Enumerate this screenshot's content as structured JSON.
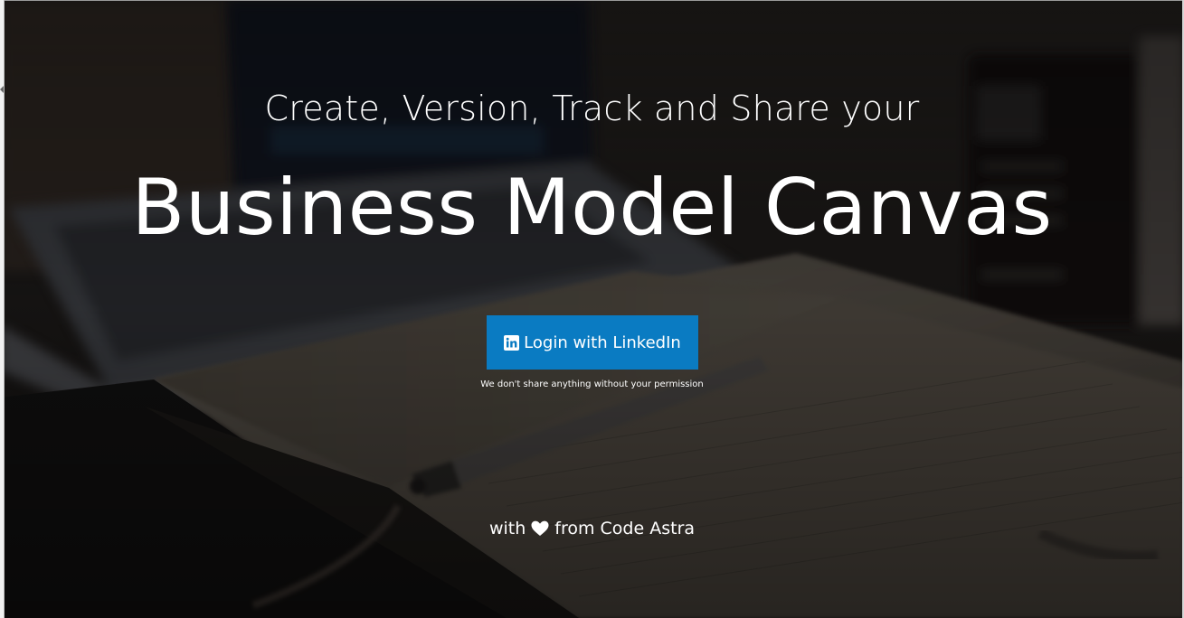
{
  "hero": {
    "subtitle": "Create, Version, Track and Share your",
    "title": "Business Model Canvas"
  },
  "login": {
    "label": "Login with LinkedIn",
    "icon": "linkedin-icon",
    "color": "#0a7bc2"
  },
  "privacy_note": "We don't share anything without your permission",
  "footer": {
    "prefix": "with",
    "icon": "heart-icon",
    "suffix": "from Code Astra"
  }
}
